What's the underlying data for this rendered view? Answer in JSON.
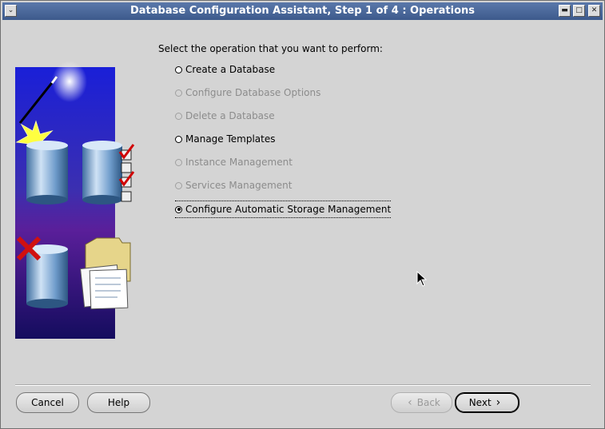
{
  "window": {
    "title": "Database Configuration Assistant, Step 1 of 4 : Operations",
    "menu_icon": "chevron-down-icon",
    "controls": [
      "minimize-icon",
      "maximize-icon",
      "close-icon"
    ]
  },
  "main": {
    "prompt": "Select the operation that you want to perform:",
    "options": [
      {
        "label": "Create a Database",
        "enabled": true,
        "selected": false
      },
      {
        "label": "Configure Database Options",
        "enabled": false,
        "selected": false
      },
      {
        "label": "Delete a Database",
        "enabled": false,
        "selected": false
      },
      {
        "label": "Manage Templates",
        "enabled": true,
        "selected": false
      },
      {
        "label": "Instance Management",
        "enabled": false,
        "selected": false
      },
      {
        "label": "Services Management",
        "enabled": false,
        "selected": false
      },
      {
        "label": "Configure Automatic Storage Management",
        "enabled": true,
        "selected": true
      }
    ]
  },
  "buttons": {
    "cancel": "Cancel",
    "help": "Help",
    "back": "Back",
    "next": "Next"
  },
  "colors": {
    "titlebar": "#4a6899",
    "background": "#d4d4d4",
    "disabled_text": "#8c8c8c"
  }
}
